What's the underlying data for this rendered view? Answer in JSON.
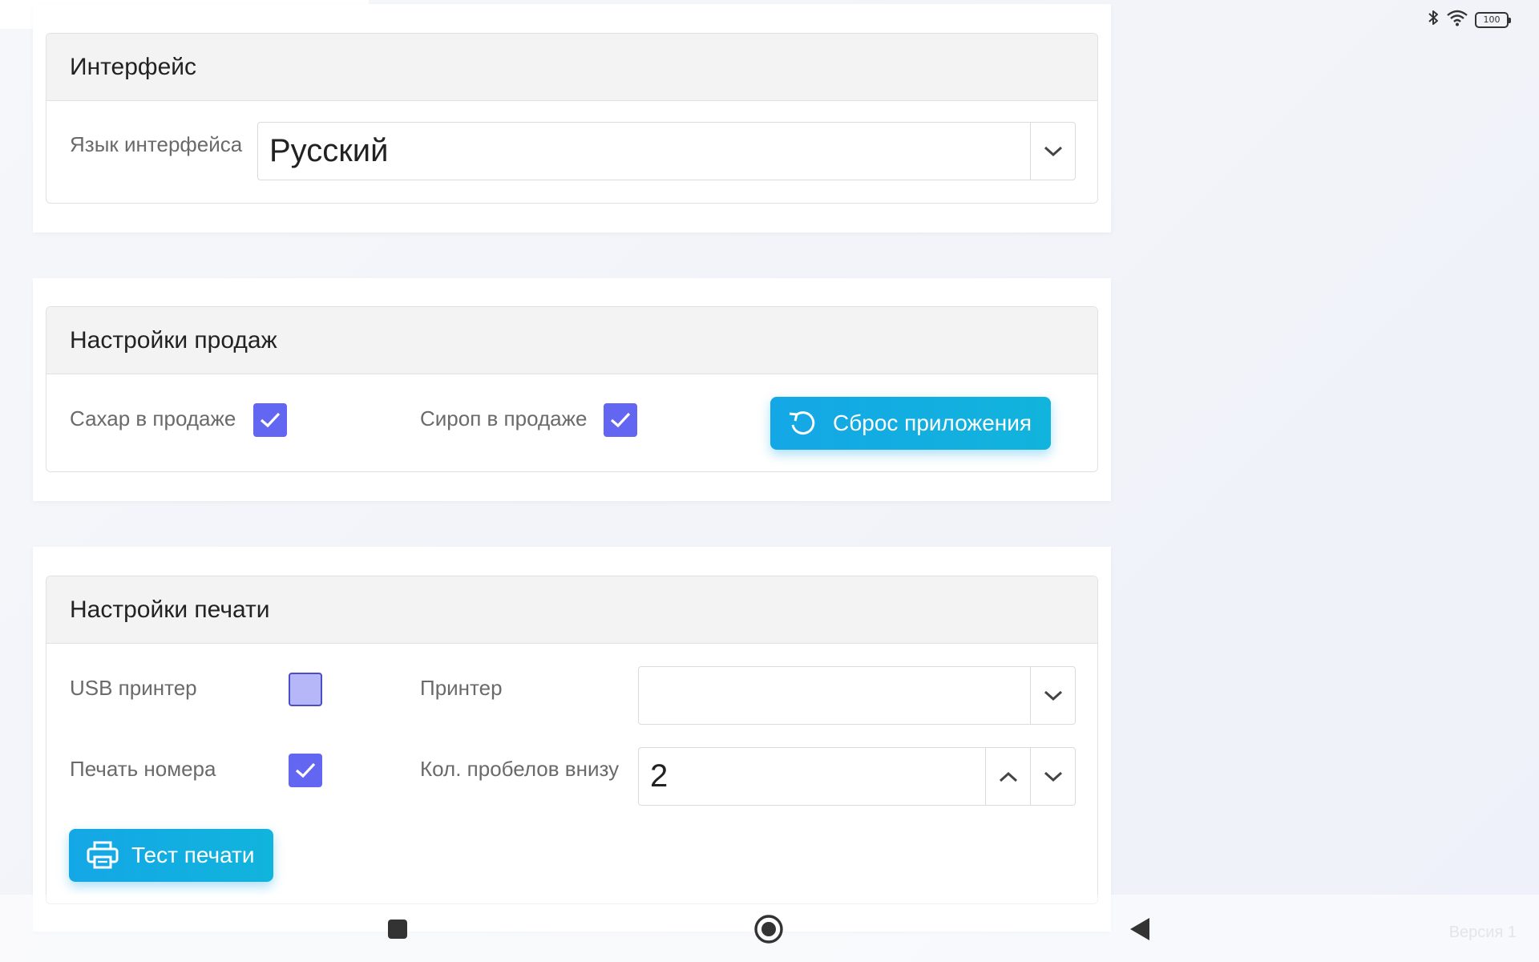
{
  "status": {
    "battery": "100"
  },
  "interface": {
    "title": "Интерфейс",
    "language_label": "Язык интерфейса",
    "language_value": "Русский"
  },
  "sales": {
    "title": "Настройки продаж",
    "sugar_label": "Сахар в продаже",
    "sugar_checked": true,
    "syrup_label": "Сироп в продаже",
    "syrup_checked": true,
    "reset_button": "Сброс приложения"
  },
  "printing": {
    "title": "Настройки печати",
    "usb_label": "USB принтер",
    "usb_checked": false,
    "printer_label": "Принтер",
    "printer_value": "",
    "print_number_label": "Печать номера",
    "print_number_checked": true,
    "spaces_label": "Кол. пробелов внизу",
    "spaces_value": "2",
    "test_button": "Тест печати"
  },
  "footer": {
    "version": "Версия 1"
  },
  "colors": {
    "accent": "#14a7e6",
    "checkbox": "#6366f1"
  },
  "icons": [
    "bluetooth-icon",
    "wifi-icon",
    "battery-icon",
    "chevron-down-icon",
    "chevron-up-icon",
    "check-icon",
    "reset-icon",
    "printer-icon",
    "recent-apps-icon",
    "home-icon",
    "back-icon"
  ]
}
